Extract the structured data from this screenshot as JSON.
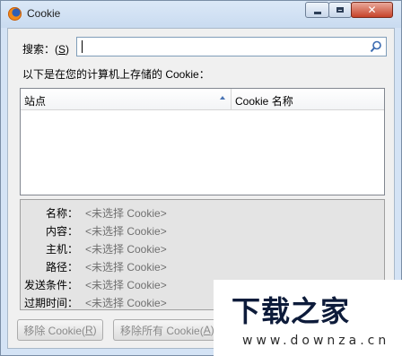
{
  "window": {
    "title": "Cookie",
    "controls": {
      "minimize_icon": "minimize-icon",
      "maximize_icon": "maximize-icon",
      "close_icon": "close-icon",
      "close_glyph": "✕"
    }
  },
  "search": {
    "label_prefix": "搜索：(",
    "label_key": "S",
    "label_suffix": ")",
    "value": "",
    "placeholder": "",
    "icon": "search-icon"
  },
  "list_caption": "以下是在您的计算机上存储的 Cookie：",
  "tree": {
    "columns": [
      {
        "label": "站点",
        "sorted": "ascending"
      },
      {
        "label": "Cookie 名称"
      }
    ],
    "rows": []
  },
  "details": [
    {
      "key": "名称：",
      "value": "<未选择 Cookie>"
    },
    {
      "key": "内容：",
      "value": "<未选择 Cookie>"
    },
    {
      "key": "主机：",
      "value": "<未选择 Cookie>"
    },
    {
      "key": "路径：",
      "value": "<未选择 Cookie>"
    },
    {
      "key": "发送条件：",
      "value": "<未选择 Cookie>"
    },
    {
      "key": "过期时间：",
      "value": "<未选择 Cookie>"
    }
  ],
  "buttons": {
    "remove_text": "移除 Cookie(",
    "remove_key": "R",
    "remove_suffix": ")",
    "remove_all_text": "移除所有 Cookie(",
    "remove_all_key": "A",
    "remove_all_suffix": ")"
  },
  "watermark": {
    "text": "下载之家",
    "url": "www.downza.cn"
  },
  "colors": {
    "accent": "#4a74b4",
    "close": "#c7432a",
    "disabled_text": "#8a8a8a"
  }
}
